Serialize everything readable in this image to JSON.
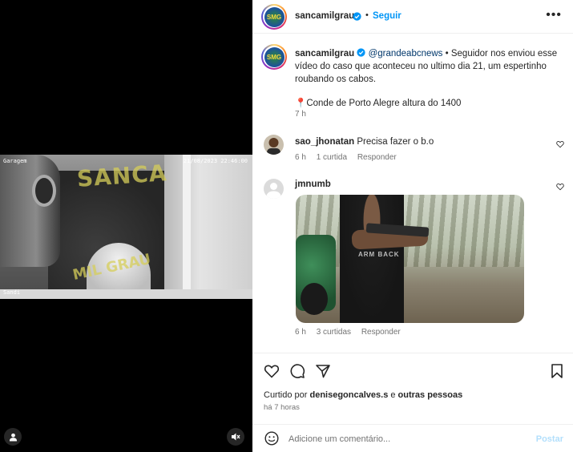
{
  "media": {
    "watermark": "SANCA",
    "watermark_bottom": "MIL GRAU",
    "cam_label": "Garagem",
    "cam_timestamp": "21/08/2023 22:46:00",
    "cam_name": "Sandi"
  },
  "header": {
    "username": "sancamilgrau",
    "follow_label": "Seguir",
    "separator": "•",
    "more_label": "•••"
  },
  "caption": {
    "username": "sancamilgrau",
    "mention": "@grandeabcnews",
    "text": " • Seguidor nos enviou esse vídeo do caso que aconteceu no ultimo dia 21, um espertinho roubando os cabos.",
    "location_icon": "📍",
    "location": "Conde de Porto Alegre altura do 1400",
    "time": "7 h"
  },
  "comments": [
    {
      "username": "sao_jhonatan",
      "text": "Precisa fazer o b.o",
      "time": "6 h",
      "likes": "1 curtida",
      "reply": "Responder"
    },
    {
      "username": "jmnumb",
      "text": "",
      "gif_text": "ARM BACK",
      "time": "6 h",
      "likes": "3 curtidas",
      "reply": "Responder"
    }
  ],
  "footer": {
    "liked_by_prefix": "Curtido por ",
    "liked_by_user": "denisegoncalves.s",
    "liked_by_suffix": " e ",
    "liked_by_others": "outras pessoas",
    "ago": "há 7 horas",
    "comment_placeholder": "Adicione um comentário...",
    "post_label": "Postar"
  },
  "colors": {
    "accent": "#0095f6",
    "post_disabled": "#b2dffc",
    "muted": "#737373"
  }
}
